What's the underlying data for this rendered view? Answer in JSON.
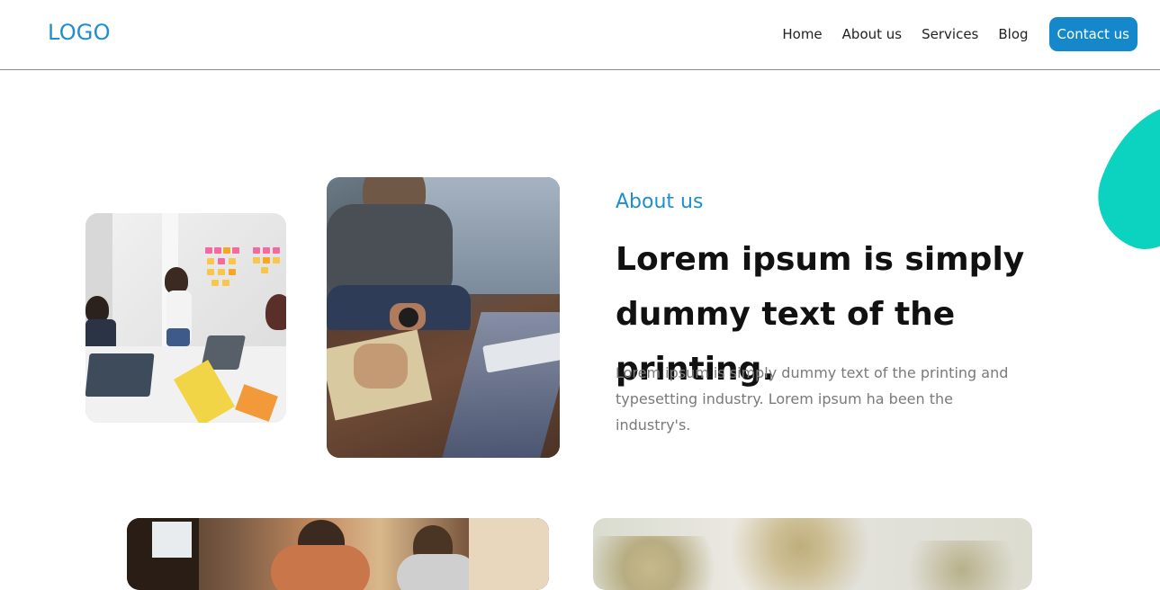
{
  "header": {
    "logo": "LOGO",
    "nav": [
      "Home",
      "About us",
      "Services",
      "Blog"
    ],
    "cta": "Contact us"
  },
  "about": {
    "eyebrow": "About us",
    "headline": "Lorem ipsum is simply dummy text of the printing.",
    "body": "Lorem ipsum is simply dummy text of the printing and typesetting industry. Lorem ipsum ha been the industry's."
  },
  "colors": {
    "accent": "#1f8ecd",
    "cta_bg": "#1588cc",
    "blob": "#0cd3bf",
    "body_text": "#7a7a7a"
  }
}
